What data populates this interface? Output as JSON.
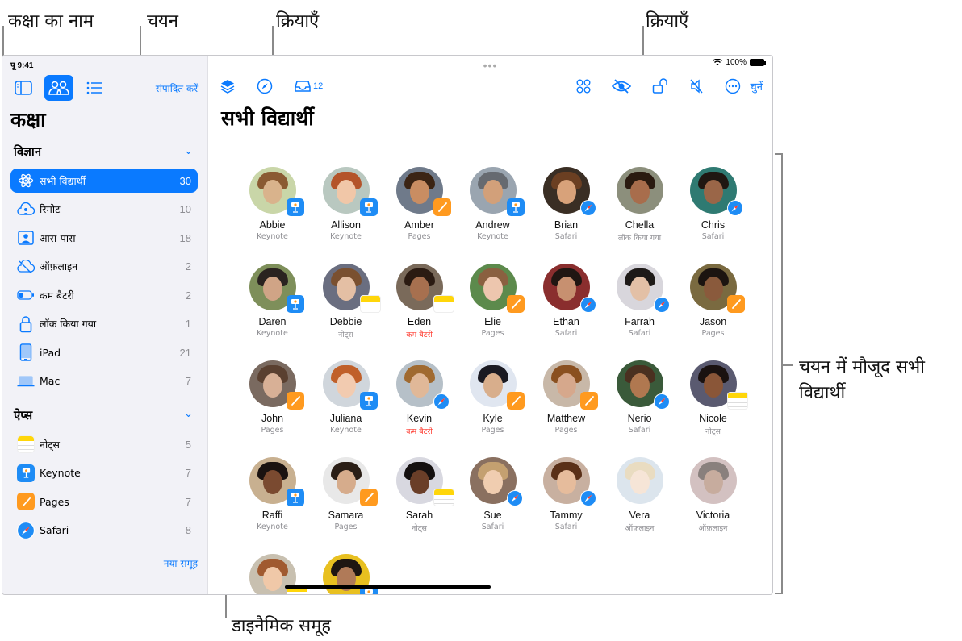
{
  "callouts": {
    "class_name": "कक्षा का नाम",
    "selection": "चयन",
    "actions_left": "क्रियाएँ",
    "actions_right": "क्रियाएँ",
    "students_in_selection_line1": "चयन में मौजूद सभी",
    "students_in_selection_line2": "विद्यार्थी",
    "dynamic_groups": "डाइनैमिक समूह"
  },
  "status_bar": {
    "time": "पू 9:41",
    "battery": "100%"
  },
  "sidebar": {
    "edit_label": "संपादित करें",
    "class_title": "कक्षा",
    "sections": [
      {
        "title": "विज्ञान",
        "items": [
          {
            "icon": "atom-icon",
            "label": "सभी विद्यार्थी",
            "count": "30",
            "selected": true
          },
          {
            "icon": "remote-cloud-icon",
            "label": "रिमोट",
            "count": "10"
          },
          {
            "icon": "nearby-person-icon",
            "label": "आस-पास",
            "count": "18"
          },
          {
            "icon": "offline-cloud-icon",
            "label": "ऑफ़लाइन",
            "count": "2"
          },
          {
            "icon": "low-battery-icon",
            "label": "कम बैटरी",
            "count": "2"
          },
          {
            "icon": "lock-icon",
            "label": "लॉक किया गया",
            "count": "1"
          },
          {
            "icon": "ipad-icon",
            "label": "iPad",
            "count": "21"
          },
          {
            "icon": "mac-laptop-icon",
            "label": "Mac",
            "count": "7"
          }
        ]
      },
      {
        "title": "ऐप्स",
        "items": [
          {
            "icon": "notes-app-icon",
            "label": "नोट्स",
            "count": "5"
          },
          {
            "icon": "keynote-app-icon",
            "label": "Keynote",
            "count": "7"
          },
          {
            "icon": "pages-app-icon",
            "label": "Pages",
            "count": "7"
          },
          {
            "icon": "safari-app-icon",
            "label": "Safari",
            "count": "8"
          }
        ]
      }
    ],
    "new_group_label": "नया समूह"
  },
  "main": {
    "title": "सभी विद्यार्थी",
    "toolbar_left": [
      {
        "icon": "layers-icon"
      },
      {
        "icon": "compass-icon"
      },
      {
        "icon": "inbox-tray-icon",
        "badge": "12"
      }
    ],
    "toolbar_right": [
      {
        "icon": "grid-apps-icon"
      },
      {
        "icon": "eye-slash-icon"
      },
      {
        "icon": "unlock-icon"
      },
      {
        "icon": "mute-speaker-icon"
      },
      {
        "icon": "more-ellipsis-icon"
      }
    ],
    "choose_label": "चुनें",
    "accent_color": "#0a7aff",
    "warning_color": "#ff3b30",
    "students": [
      {
        "name": "Abbie",
        "status": "Keynote",
        "app": "keynote"
      },
      {
        "name": "Allison",
        "status": "Keynote",
        "app": "keynote"
      },
      {
        "name": "Amber",
        "status": "Pages",
        "app": "pages"
      },
      {
        "name": "Andrew",
        "status": "Keynote",
        "app": "keynote"
      },
      {
        "name": "Brian",
        "status": "Safari",
        "app": "safari"
      },
      {
        "name": "Chella",
        "status": "लॉक किया गया",
        "app": ""
      },
      {
        "name": "Chris",
        "status": "Safari",
        "app": "safari"
      },
      {
        "name": "Daren",
        "status": "Keynote",
        "app": "keynote"
      },
      {
        "name": "Debbie",
        "status": "नोट्स",
        "app": "notes"
      },
      {
        "name": "Eden",
        "status": "कम बैटरी",
        "app": "notes",
        "warn": true
      },
      {
        "name": "Elie",
        "status": "Pages",
        "app": "pages"
      },
      {
        "name": "Ethan",
        "status": "Safari",
        "app": "safari"
      },
      {
        "name": "Farrah",
        "status": "Safari",
        "app": "safari"
      },
      {
        "name": "Jason",
        "status": "Pages",
        "app": "pages"
      },
      {
        "name": "John",
        "status": "Pages",
        "app": "pages"
      },
      {
        "name": "Juliana",
        "status": "Keynote",
        "app": "keynote"
      },
      {
        "name": "Kevin",
        "status": "कम बैटरी",
        "app": "safari",
        "warn": true
      },
      {
        "name": "Kyle",
        "status": "Pages",
        "app": "pages"
      },
      {
        "name": "Matthew",
        "status": "Pages",
        "app": "pages"
      },
      {
        "name": "Nerio",
        "status": "Safari",
        "app": "safari"
      },
      {
        "name": "Nicole",
        "status": "नोट्स",
        "app": "notes"
      },
      {
        "name": "Raffi",
        "status": "Keynote",
        "app": "keynote"
      },
      {
        "name": "Samara",
        "status": "Pages",
        "app": "pages"
      },
      {
        "name": "Sarah",
        "status": "नोट्स",
        "app": "notes"
      },
      {
        "name": "Sue",
        "status": "Safari",
        "app": "safari"
      },
      {
        "name": "Tammy",
        "status": "Safari",
        "app": "safari"
      },
      {
        "name": "Vera",
        "status": "ऑफ़लाइन",
        "app": "",
        "offline": true
      },
      {
        "name": "Victoria",
        "status": "ऑफ़लाइन",
        "app": "",
        "offline": true
      },
      {
        "name": "",
        "status": "",
        "app": "notes",
        "partial": true
      },
      {
        "name": "",
        "status": "",
        "app": "keynote",
        "partial": true
      }
    ]
  }
}
